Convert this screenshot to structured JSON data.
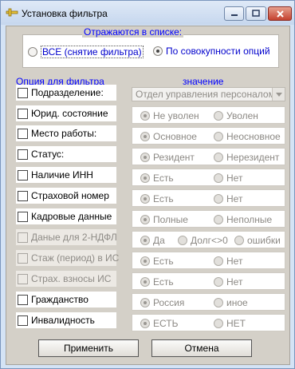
{
  "window": {
    "title": "Установка фильтра"
  },
  "display_group": {
    "label": "Отражаются в списке:",
    "all_label": "ВСЕ (снятие фильтра)",
    "combined_label": "По совокупности опций",
    "selected": "combined"
  },
  "headers": {
    "option": "Опция для фильтра",
    "value": "значение"
  },
  "options": [
    {
      "label": "Подразделение:",
      "enabled": true,
      "checked": false
    },
    {
      "label": "Юрид. состояние",
      "enabled": true,
      "checked": false
    },
    {
      "label": "Место работы:",
      "enabled": true,
      "checked": false
    },
    {
      "label": "Статус:",
      "enabled": true,
      "checked": false
    },
    {
      "label": "Наличие ИНН",
      "enabled": true,
      "checked": false
    },
    {
      "label": "Страховой номер",
      "enabled": true,
      "checked": false
    },
    {
      "label": "Кадровые данные",
      "enabled": true,
      "checked": false
    },
    {
      "label": "Даные для 2-НДФЛ",
      "enabled": false,
      "checked": false
    },
    {
      "label": "Стаж (период) в ИС",
      "enabled": false,
      "checked": false
    },
    {
      "label": "Страх. взносы ИС",
      "enabled": false,
      "checked": false
    },
    {
      "label": "Гражданство",
      "enabled": true,
      "checked": false
    },
    {
      "label": "Инвалидность",
      "enabled": true,
      "checked": false
    }
  ],
  "values": {
    "department_select": "Отдел управления персоналом",
    "legal_state": {
      "a": "Не уволен",
      "b": "Уволен",
      "selected": "a"
    },
    "workplace": {
      "a": "Основное",
      "b": "Неосновное",
      "selected": "a"
    },
    "status": {
      "a": "Резидент",
      "b": "Нерезидент",
      "selected": "a"
    },
    "inn": {
      "a": "Есть",
      "b": "Нет",
      "selected": "a"
    },
    "insurance_number": {
      "a": "Есть",
      "b": "Нет",
      "selected": "a"
    },
    "hr_data": {
      "a": "Полные",
      "b": "Неполные",
      "selected": "a"
    },
    "ndfl": {
      "a": "Да",
      "b": "Долг<>0",
      "c": "ошибки",
      "selected": "a"
    },
    "service_period": {
      "a": "Есть",
      "b": "Нет",
      "selected": "a"
    },
    "contributions": {
      "a": "Есть",
      "b": "Нет",
      "selected": "a"
    },
    "citizenship": {
      "a": "Россия",
      "b": "иное",
      "selected": "a"
    },
    "disability": {
      "a": "ЕСТЬ",
      "b": "НЕТ",
      "selected": "a"
    }
  },
  "buttons": {
    "apply": "Применить",
    "cancel": "Отмена"
  }
}
